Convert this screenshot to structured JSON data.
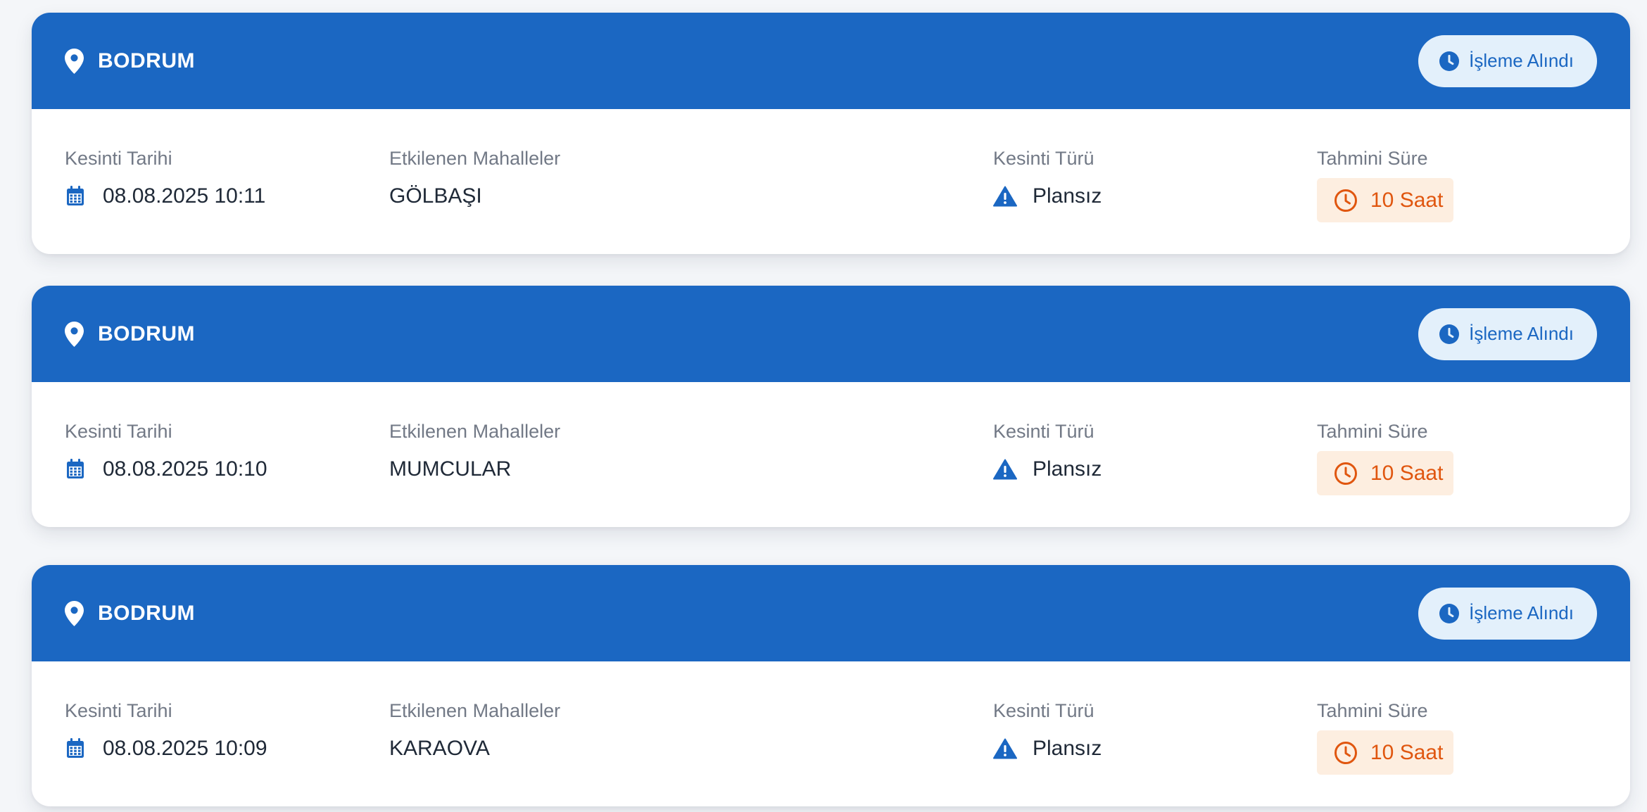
{
  "colors": {
    "header_blue": "#1b67c2",
    "badge_bg": "#e3f0fb",
    "duration_orange": "#e0560f",
    "duration_bg": "#fdeee0"
  },
  "icons": {
    "location": "map-pin-icon",
    "status": "clock-filled-icon",
    "date": "calendar-icon",
    "type": "warning-triangle-icon",
    "duration": "clock-outline-icon"
  },
  "labels": {
    "date": "Kesinti Tarihi",
    "area": "Etkilenen Mahalleler",
    "type": "Kesinti Türü",
    "duration": "Tahmini Süre"
  },
  "outages": [
    {
      "district": "BODRUM",
      "status": "İşleme Alındı",
      "date": "08.08.2025 10:11",
      "neighborhoods": "GÖLBAŞI",
      "type": "Plansız",
      "duration": "10 Saat"
    },
    {
      "district": "BODRUM",
      "status": "İşleme Alındı",
      "date": "08.08.2025 10:10",
      "neighborhoods": "MUMCULAR",
      "type": "Plansız",
      "duration": "10 Saat"
    },
    {
      "district": "BODRUM",
      "status": "İşleme Alındı",
      "date": "08.08.2025 10:09",
      "neighborhoods": "KARAOVA",
      "type": "Plansız",
      "duration": "10 Saat"
    }
  ]
}
